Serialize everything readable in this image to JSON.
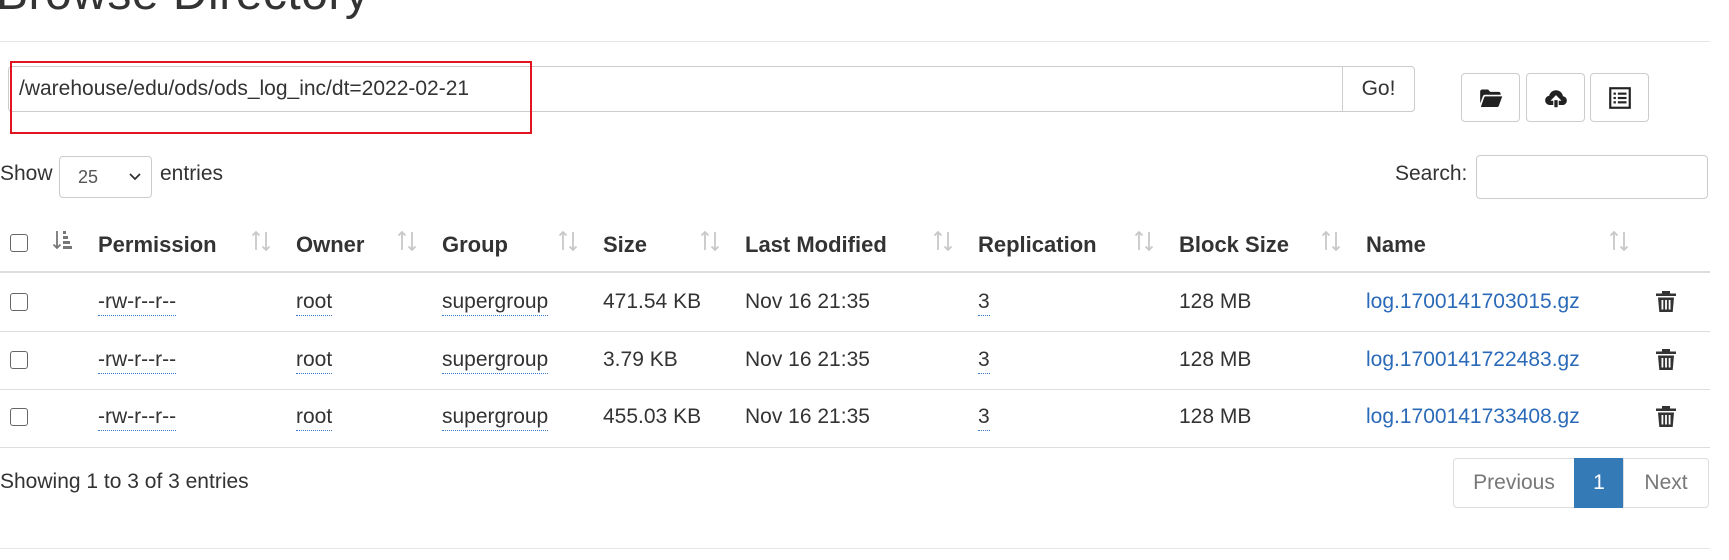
{
  "page": {
    "title": "Browse Directory"
  },
  "path_bar": {
    "value": "/warehouse/edu/ods/ods_log_inc/dt=2022-02-21",
    "go_label": "Go!"
  },
  "toolbar_icons": [
    "folder-open-icon",
    "cloud-upload-icon",
    "list-icon"
  ],
  "length_menu": {
    "show_label": "Show",
    "selected": "25",
    "entries_label": "entries"
  },
  "search": {
    "label": "Search:",
    "value": ""
  },
  "table": {
    "columns": [
      "Permission",
      "Owner",
      "Group",
      "Size",
      "Last Modified",
      "Replication",
      "Block Size",
      "Name"
    ],
    "rows": [
      {
        "permission": "-rw-r--r--",
        "owner": "root",
        "group": "supergroup",
        "size": "471.54 KB",
        "modified": "Nov 16 21:35",
        "replication": "3",
        "block_size": "128 MB",
        "name": "log.1700141703015.gz"
      },
      {
        "permission": "-rw-r--r--",
        "owner": "root",
        "group": "supergroup",
        "size": "3.79 KB",
        "modified": "Nov 16 21:35",
        "replication": "3",
        "block_size": "128 MB",
        "name": "log.1700141722483.gz"
      },
      {
        "permission": "-rw-r--r--",
        "owner": "root",
        "group": "supergroup",
        "size": "455.03 KB",
        "modified": "Nov 16 21:35",
        "replication": "3",
        "block_size": "128 MB",
        "name": "log.1700141733408.gz"
      }
    ]
  },
  "footer": {
    "info": "Showing 1 to 3 of 3 entries",
    "prev_label": "Previous",
    "current_page": "1",
    "next_label": "Next"
  },
  "colors": {
    "link": "#2a6ab8",
    "pager_active": "#337ab7",
    "highlight_box": "#e0151f"
  }
}
